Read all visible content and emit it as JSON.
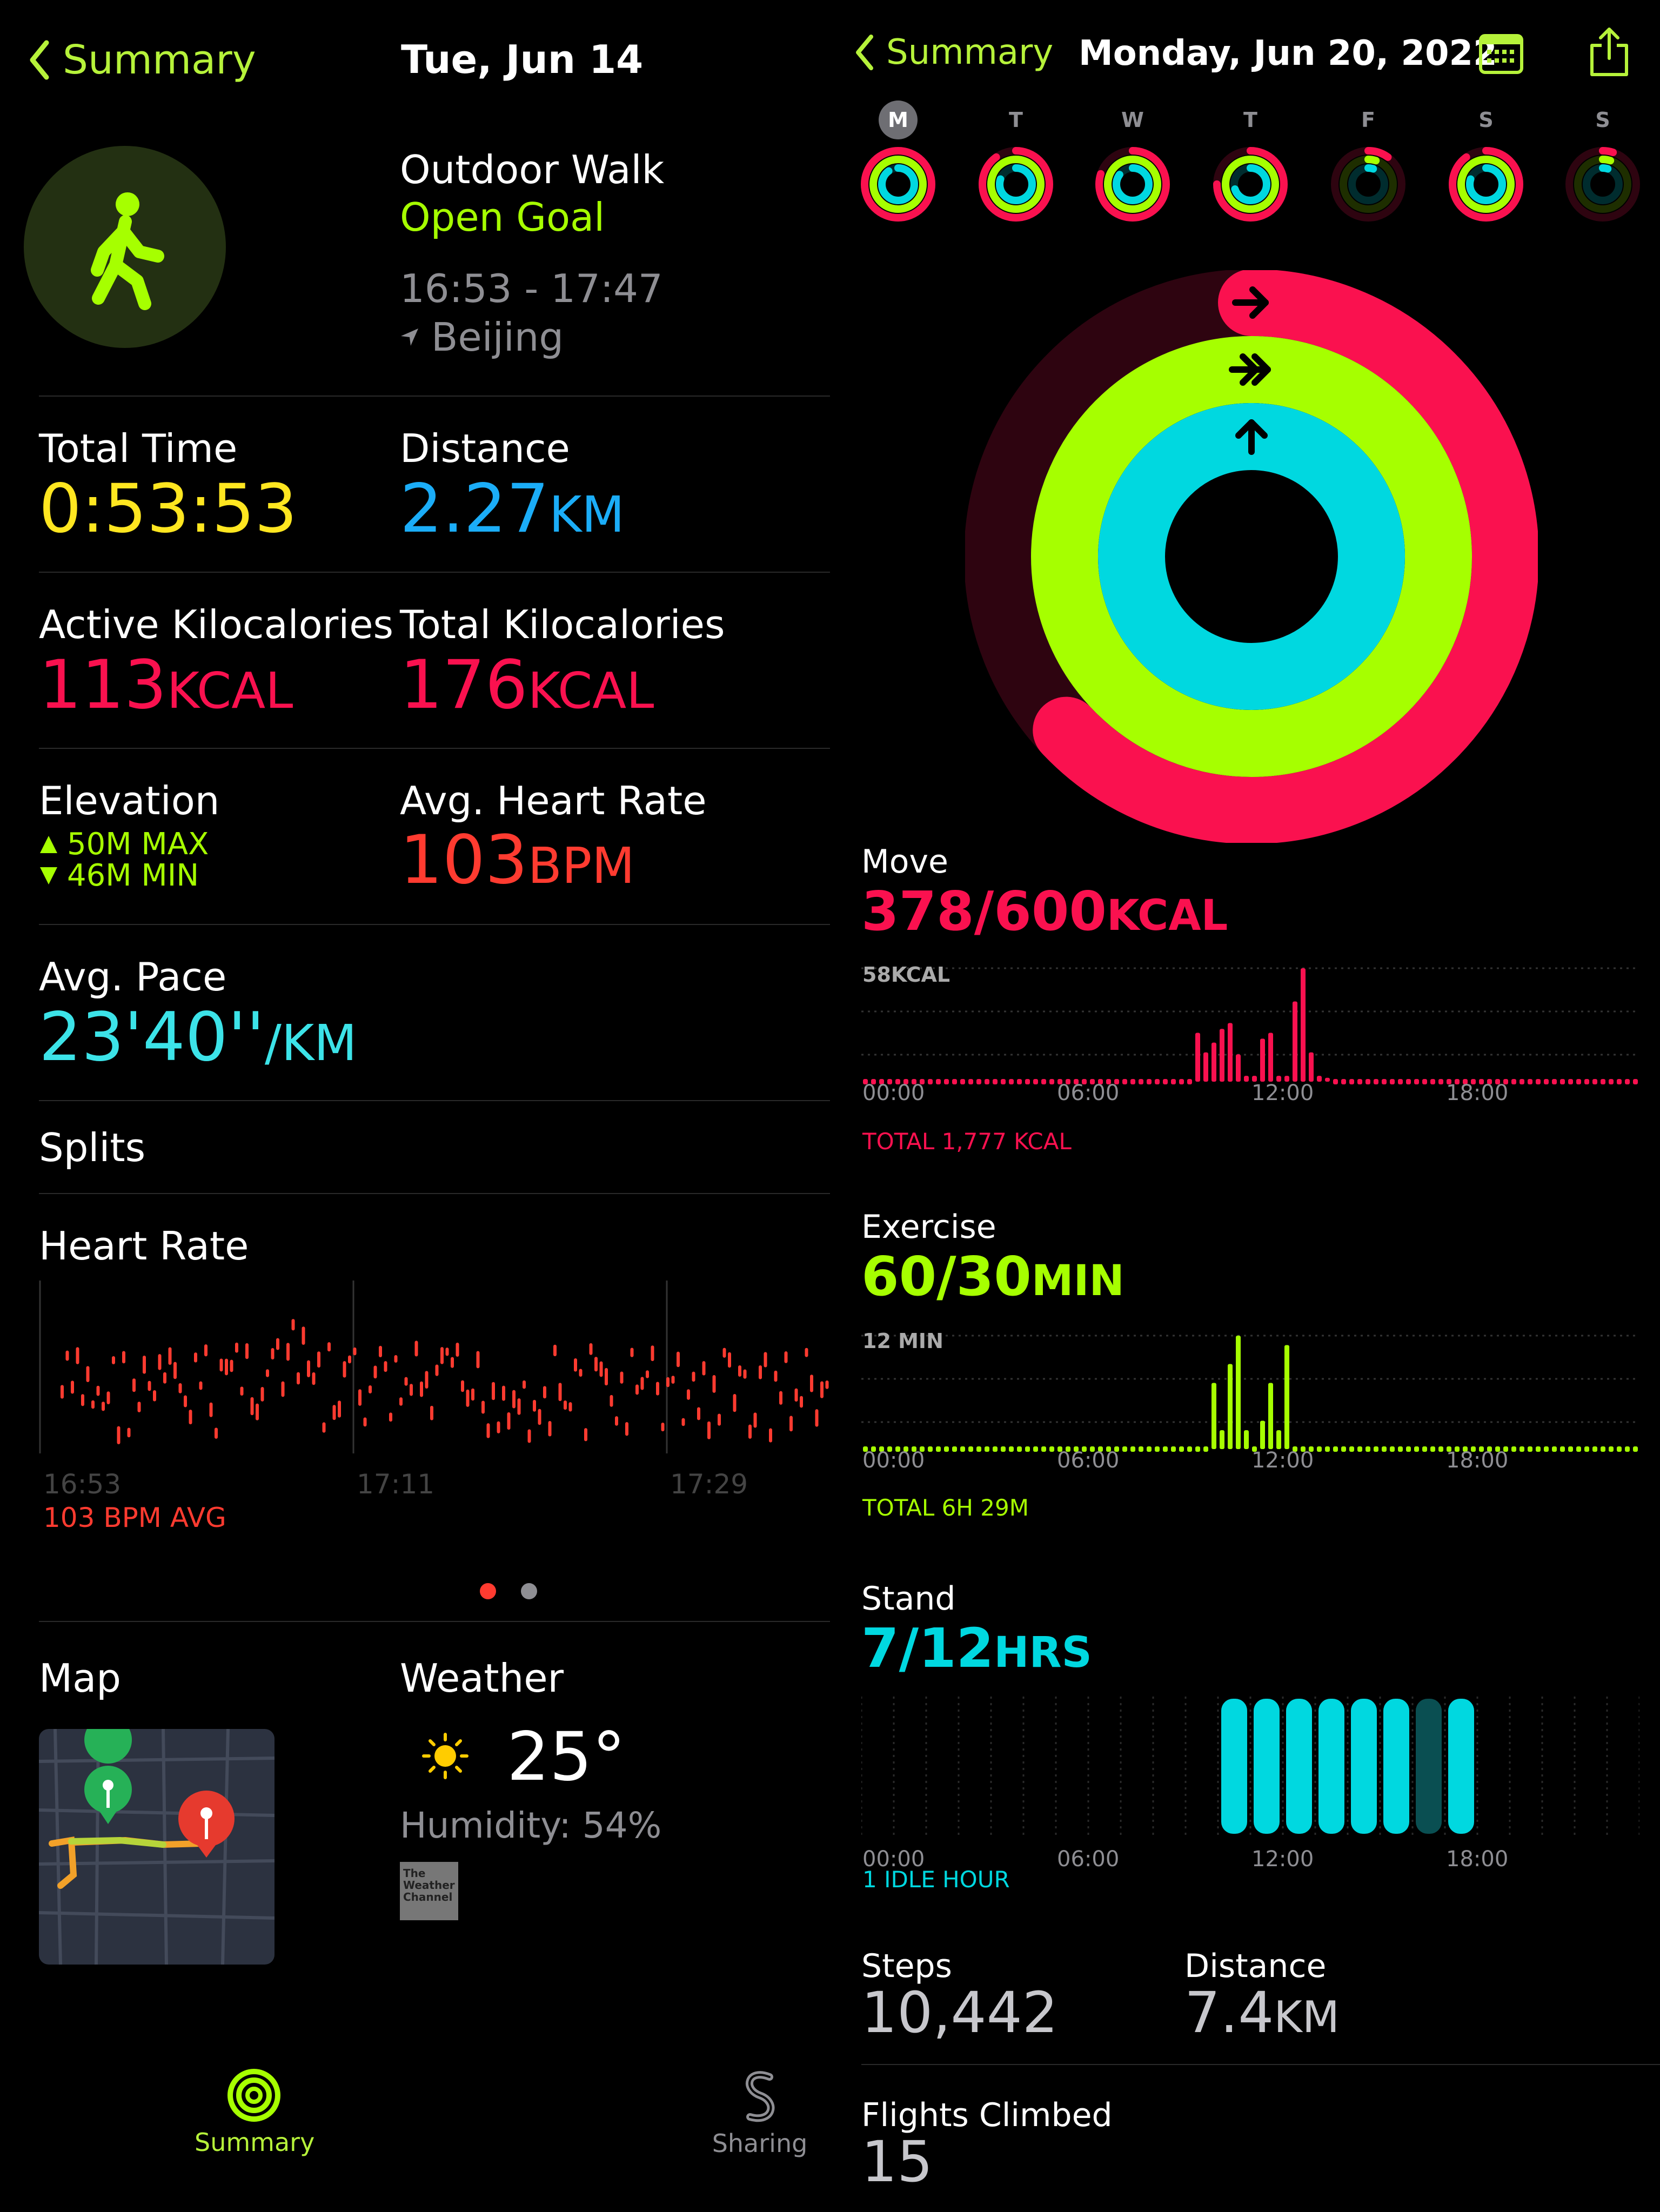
{
  "left": {
    "nav": {
      "back_label": "Summary",
      "date": "Tue, Jun 14"
    },
    "workout": {
      "name": "Outdoor Walk",
      "goal": "Open Goal",
      "time_range": "16:53 - 17:47",
      "location": "Beijing"
    },
    "metrics": {
      "total_time": {
        "label": "Total Time",
        "value": "0:53:53"
      },
      "distance": {
        "label": "Distance",
        "value": "2.27",
        "unit": "KM"
      },
      "active_kcal": {
        "label": "Active Kilocalories",
        "value": "113",
        "unit": "KCAL"
      },
      "total_kcal": {
        "label": "Total Kilocalories",
        "value": "176",
        "unit": "KCAL"
      },
      "elevation": {
        "label": "Elevation",
        "max": "50M MAX",
        "min": "46M MIN"
      },
      "avg_hr": {
        "label": "Avg. Heart Rate",
        "value": "103",
        "unit": "BPM"
      },
      "avg_pace": {
        "label": "Avg. Pace",
        "value": "23'40''",
        "unit": "/KM"
      }
    },
    "splits_label": "Splits",
    "heart_rate": {
      "label": "Heart Rate",
      "x_ticks": [
        "16:53",
        "17:11",
        "17:29"
      ],
      "avg_label": "103 BPM AVG"
    },
    "map_label": "Map",
    "weather": {
      "label": "Weather",
      "temp": "25°",
      "humidity": "Humidity: 54%",
      "provider": "The Weather Channel"
    }
  },
  "tabbar": {
    "summary": "Summary",
    "sharing": "Sharing"
  },
  "right": {
    "nav": {
      "back_label": "Summary",
      "date": "Monday, Jun 20, 2022"
    },
    "week_days": [
      "M",
      "T",
      "W",
      "T",
      "F",
      "S",
      "S"
    ],
    "move": {
      "label": "Move",
      "value": "378/600",
      "unit": "KCAL",
      "peak_label": "58KCAL",
      "total": "TOTAL 1,777 KCAL"
    },
    "exercise": {
      "label": "Exercise",
      "value": "60/30",
      "unit": "MIN",
      "peak_label": "12 MIN",
      "total": "TOTAL 6H 29M"
    },
    "stand": {
      "label": "Stand",
      "value": "7/12",
      "unit": "HRS",
      "idle": "1 IDLE HOUR"
    },
    "time_ticks": [
      "00:00",
      "06:00",
      "12:00",
      "18:00"
    ],
    "steps": {
      "label": "Steps",
      "value": "10,442"
    },
    "distance": {
      "label": "Distance",
      "value": "7.4",
      "unit": "KM"
    },
    "flights": {
      "label": "Flights Climbed",
      "value": "15"
    }
  },
  "colors": {
    "move": "#fa114f",
    "exercise": "#a6ff00",
    "stand": "#00d8e0",
    "hr": "#ff3b30",
    "accent": "#b6f23a",
    "distance": "#1badf8",
    "time": "#ffe620"
  },
  "chart_data": [
    {
      "type": "bar",
      "title": "Move",
      "x_ticks": [
        "00:00",
        "06:00",
        "12:00",
        "18:00"
      ],
      "hours": [
        0,
        0,
        0,
        0,
        0,
        0,
        0,
        0,
        0,
        0,
        0,
        0,
        0,
        0,
        0,
        0,
        0,
        0,
        0,
        0,
        0,
        0,
        0,
        0
      ],
      "values_by_slot_note": "",
      "slots": 96,
      "nonzero": {
        "41": 25,
        "42": 15,
        "43": 20,
        "44": 27,
        "45": 30,
        "46": 14,
        "47": 3,
        "48": 3,
        "49": 22,
        "50": 25,
        "51": 3,
        "52": 3,
        "53": 41,
        "54": 58,
        "55": 15,
        "56": 3,
        "57": 2
      },
      "ymax": 58
    },
    {
      "type": "bar",
      "title": "Exercise",
      "x_ticks": [
        "00:00",
        "06:00",
        "12:00",
        "18:00"
      ],
      "slots": 96,
      "nonzero": {
        "43": 7,
        "44": 2,
        "45": 9,
        "46": 12,
        "47": 2,
        "49": 3,
        "50": 7,
        "51": 2,
        "52": 11
      },
      "ymax": 12
    },
    {
      "type": "bar",
      "title": "Stand",
      "x_ticks": [
        "00:00",
        "06:00",
        "12:00",
        "18:00"
      ],
      "hours_stood": [
        11,
        12,
        13,
        14,
        15,
        16,
        18
      ],
      "hours_idle": [
        17
      ]
    },
    {
      "type": "scatter",
      "title": "Heart Rate",
      "x_ticks": [
        "16:53",
        "17:11",
        "17:29"
      ]
    }
  ]
}
